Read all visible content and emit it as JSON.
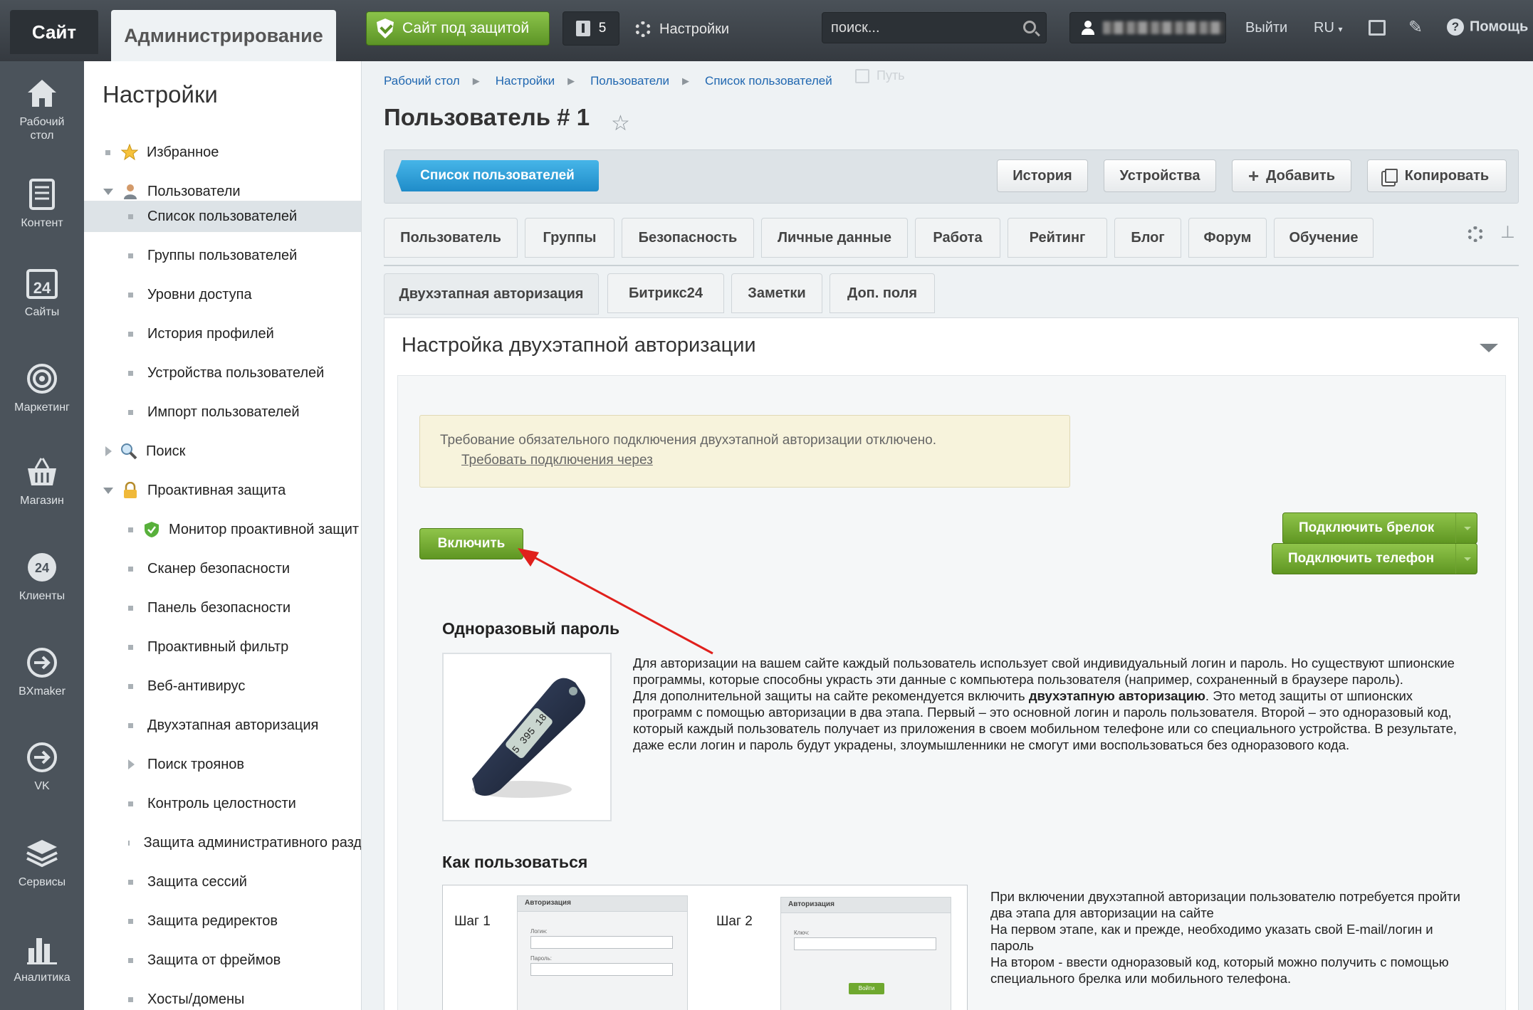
{
  "topbar": {
    "site_tab": "Сайт",
    "admin_tab": "Администрирование",
    "protection": "Сайт под защитой",
    "notifications_count": "5",
    "settings": "Настройки",
    "search_placeholder": "поиск...",
    "logout": "Выйти",
    "lang": "RU",
    "help": "Помощь"
  },
  "leftnav": [
    {
      "label1": "Рабочий",
      "label2": "стол",
      "icon": "home-icon"
    },
    {
      "label1": "Контент",
      "label2": "",
      "icon": "document-icon"
    },
    {
      "label1": "Сайты",
      "label2": "",
      "icon": "calendar-24-icon"
    },
    {
      "label1": "Маркетинг",
      "label2": "",
      "icon": "target-icon"
    },
    {
      "label1": "Магазин",
      "label2": "",
      "icon": "basket-icon"
    },
    {
      "label1": "Клиенты",
      "label2": "",
      "icon": "clients-24-icon"
    },
    {
      "label1": "BXmaker",
      "label2": "",
      "icon": "arrow-circle-icon"
    },
    {
      "label1": "VK",
      "label2": "",
      "icon": "arrow-circle-icon"
    },
    {
      "label1": "Сервисы",
      "label2": "",
      "icon": "layers-icon"
    },
    {
      "label1": "Аналитика",
      "label2": "",
      "icon": "bar-chart-icon"
    }
  ],
  "sidebar": {
    "title": "Настройки",
    "items": [
      {
        "label": "Избранное"
      },
      {
        "label": "Пользователи"
      },
      {
        "label": "Список пользователей"
      },
      {
        "label": "Группы пользователей"
      },
      {
        "label": "Уровни доступа"
      },
      {
        "label": "История профилей"
      },
      {
        "label": "Устройства пользователей"
      },
      {
        "label": "Импорт пользователей"
      },
      {
        "label": "Поиск"
      },
      {
        "label": "Проактивная защита"
      },
      {
        "label": "Монитор проактивной защит"
      },
      {
        "label": "Сканер безопасности"
      },
      {
        "label": "Панель безопасности"
      },
      {
        "label": "Проактивный фильтр"
      },
      {
        "label": "Веб-антивирус"
      },
      {
        "label": "Двухэтапная авторизация"
      },
      {
        "label": "Поиск троянов"
      },
      {
        "label": "Контроль целостности"
      },
      {
        "label": "Защита административного разд"
      },
      {
        "label": "Защита сессий"
      },
      {
        "label": "Защита редиректов"
      },
      {
        "label": "Защита от фреймов"
      },
      {
        "label": "Хосты/домены"
      }
    ]
  },
  "breadcrumb": [
    "Рабочий стол",
    "Настройки",
    "Пользователи",
    "Список пользователей"
  ],
  "path_label": "Путь",
  "page_title": "Пользователь # 1",
  "toolbar": {
    "list_button": "Список пользователей",
    "history": "История",
    "devices": "Устройства",
    "add": "Добавить",
    "copy": "Копировать"
  },
  "tabs_row1": [
    "Пользователь",
    "Группы",
    "Безопасность",
    "Личные данные",
    "Работа",
    "Рейтинг",
    "Блог",
    "Форум",
    "Обучение"
  ],
  "tabs_row2": [
    "Двухэтапная авторизация",
    "Битрикс24",
    "Заметки",
    "Доп. поля"
  ],
  "panel": {
    "title": "Настройка двухэтапной авторизации",
    "note_line1": "Требование обязательного подключения двухэтапной авторизации отключено.",
    "note_line2": "Требовать подключения через",
    "enable_button": "Включить",
    "connect_fob": "Подключить брелок",
    "connect_phone": "Подключить телефон",
    "otp_heading": "Одноразовый пароль",
    "fob_display": "5 395 18",
    "otp_p1": "Для авторизации на вашем сайте каждый пользователь использует свой индивидуальный логин и пароль. Но существуют шпионские программы, которые способны украсть эти данные с компьютера пользователя (например, сохраненный в браузере пароль).",
    "otp_p2_a": "Для дополнительной защиты на сайте рекомендуется включить ",
    "otp_p2_bold": "двухэтапную авторизацию",
    "otp_p2_b": ". Это метод защиты от шпионских программ с помощью авторизации в два этапа. Первый – это основной логин и пароль пользователя. Второй – это одноразовый код, который каждый пользователь получает из приложения в своем мобильном телефоне или со специального устройства. В результате, даже если логин и пароль будут украдены, злоумышленники не смогут ими воспользоваться без одноразового кода.",
    "howto_heading": "Как пользоваться",
    "step1": "Шаг 1",
    "step2": "Шаг 2",
    "mini_title": "Авторизация",
    "mini_login": "Логин:",
    "mini_password": "Пароль:",
    "mini_code": "Ключ:",
    "mini_btn": "Войти",
    "howto_p1": "При включении двухэтапной авторизации пользователю потребуется пройти два этапа для авторизации на сайте",
    "howto_p2": "На первом этапе, как и прежде, необходимо указать свой E-mail/логин и пароль",
    "howto_p3": "На втором - ввести одноразовый код, который можно получить с помощью специального брелка или мобильного телефона."
  },
  "colors": {
    "accent_green": "#6fa82f",
    "accent_blue": "#2a9ad6",
    "annotation_arrow": "#e0201c"
  }
}
